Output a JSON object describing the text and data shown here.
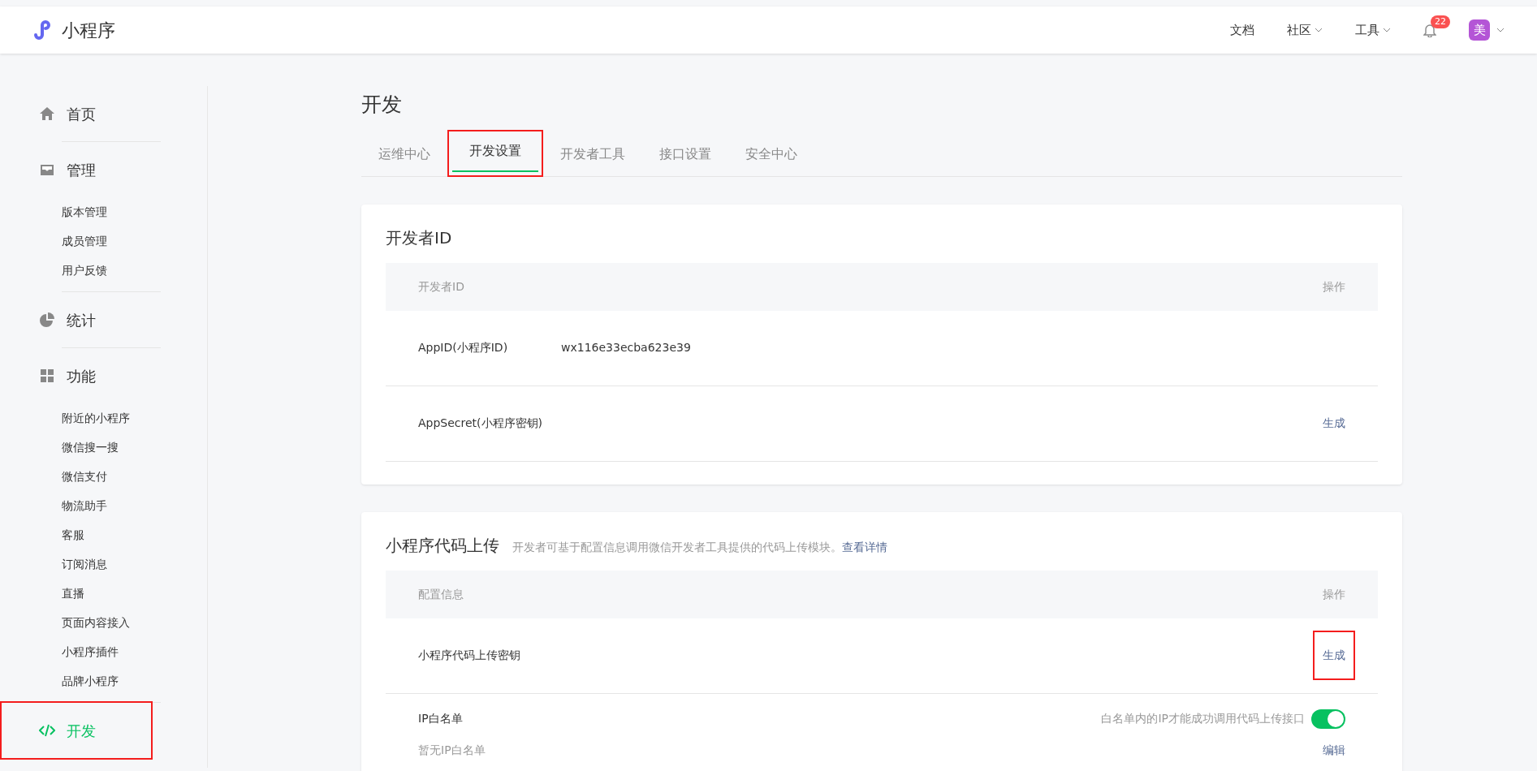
{
  "header": {
    "logo_text": "小程序",
    "nav": [
      {
        "label": "文档",
        "dropdown": false
      },
      {
        "label": "社区",
        "dropdown": true
      },
      {
        "label": "工具",
        "dropdown": true
      }
    ],
    "notification_count": "22",
    "avatar_text": "美"
  },
  "sidebar": {
    "sections": [
      {
        "label": "首页",
        "selected": false,
        "highlighted": false
      },
      {
        "label": "管理",
        "selected": false,
        "highlighted": false,
        "children": [
          {
            "label": "版本管理"
          },
          {
            "label": "成员管理"
          },
          {
            "label": "用户反馈"
          }
        ]
      },
      {
        "label": "统计",
        "selected": false,
        "highlighted": false
      },
      {
        "label": "功能",
        "selected": false,
        "highlighted": false,
        "children": [
          {
            "label": "附近的小程序"
          },
          {
            "label": "微信搜一搜"
          },
          {
            "label": "微信支付"
          },
          {
            "label": "物流助手"
          },
          {
            "label": "客服"
          },
          {
            "label": "订阅消息"
          },
          {
            "label": "直播"
          },
          {
            "label": "页面内容接入"
          },
          {
            "label": "小程序插件"
          },
          {
            "label": "品牌小程序"
          }
        ]
      },
      {
        "label": "开发",
        "selected": true,
        "highlighted": true
      }
    ]
  },
  "main": {
    "title": "开发",
    "tabs": [
      {
        "label": "运维中心",
        "selected": false,
        "highlighted": false
      },
      {
        "label": "开发设置",
        "selected": true,
        "highlighted": true
      },
      {
        "label": "开发者工具",
        "selected": false,
        "highlighted": false
      },
      {
        "label": "接口设置",
        "selected": false,
        "highlighted": false
      },
      {
        "label": "安全中心",
        "selected": false,
        "highlighted": false
      }
    ],
    "cards": [
      {
        "title": "开发者ID",
        "columns": [
          "开发者ID",
          "操作"
        ],
        "rows": [
          {
            "label": "AppID(小程序ID)",
            "value": "wx116e33ecba623e39"
          },
          {
            "label": "AppSecret(小程序密钥)",
            "action": "生成",
            "highlighted": false
          }
        ]
      },
      {
        "title": "小程序代码上传",
        "description": "开发者可基于配置信息调用微信开发者工具提供的代码上传模块。",
        "link": "查看详情",
        "columns": [
          "配置信息",
          "操作"
        ],
        "rows": [
          {
            "label": "小程序代码上传密钥",
            "action": "生成",
            "highlighted": true
          },
          {
            "label": "IP白名单",
            "note": "暂无IP白名单",
            "hint": "白名单内的IP才能成功调用代码上传接口",
            "on": true,
            "action": "编辑",
            "highlighted": false
          }
        ]
      }
    ]
  }
}
